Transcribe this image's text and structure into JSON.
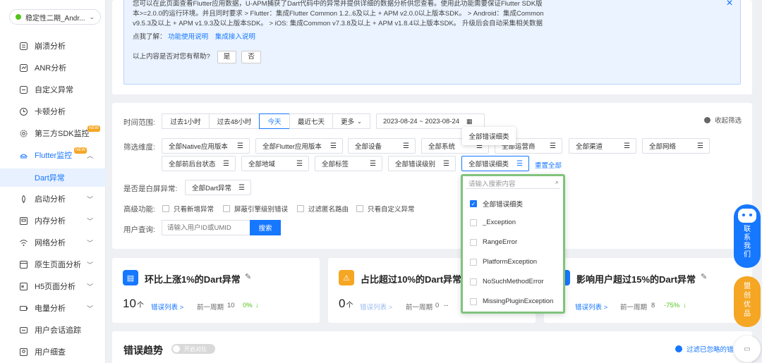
{
  "sidebar": {
    "app_name": "稳定性二期_Andr...",
    "items": [
      {
        "label": "崩溃分析"
      },
      {
        "label": "ANR分析"
      },
      {
        "label": "自定义异常"
      },
      {
        "label": "卡顿分析"
      },
      {
        "label": "第三方SDK监控",
        "badge": "NEW"
      },
      {
        "label": "Flutter监控",
        "badge": "NEW"
      },
      {
        "label": "启动分析"
      },
      {
        "label": "内存分析"
      },
      {
        "label": "网络分析"
      },
      {
        "label": "原生页面分析"
      },
      {
        "label": "H5页面分析"
      },
      {
        "label": "电量分析"
      },
      {
        "label": "用户会话追踪"
      },
      {
        "label": "用户细查"
      }
    ],
    "active_sub": "Dart异常"
  },
  "notice": {
    "text": "您可以在此页面查看Flutter应用数据，U-APM捕获了Dart代码中的异常并提供详细的数据分析供您查看。使用此功能需要保证Flutter SDK版本>=2.0.0的运行环境。并且同时要求 > Flutter：集成Flutter Common 1.2..6及以上 + APM v2.0.0以上版本SDK。 > Android：集成Common v9.5.3及以上 + APM v1.9.3及以上版本SDK。 > iOS: 集成Common v7.3.8及以上 + APM v1.8.4以上版本SDK。 升级后会自动采集相关数据",
    "learn_prefix": "点我了解：",
    "link1": "功能使用说明",
    "link2": "集成接入说明",
    "help_q": "以上内容是否对您有帮助?",
    "yes": "是",
    "no": "否"
  },
  "filters": {
    "time_label": "时间范围:",
    "time_options": [
      "过去1小时",
      "过去48小时",
      "今天",
      "最近七天",
      "更多"
    ],
    "date_range": "2023-08-24 ~ 2023-08-24",
    "collapse": "收起筛选",
    "dim_label": "筛选维度:",
    "dims_row1": [
      "全部Native应用版本",
      "全部Flutter应用版本",
      "全部设备",
      "全部系统",
      "全部运营商",
      "全部渠道",
      "全部网络"
    ],
    "dims_row2": [
      "全部前后台状态",
      "全部地域",
      "全部标签",
      "全部错误级别",
      "全部错误细类"
    ],
    "reset": "重置全部",
    "white_label": "是否是白屏异常:",
    "white_value": "全部Dart异常",
    "adv_label": "高级功能:",
    "adv_options": [
      "只看新增异常",
      "屏蔽引擎级别错误",
      "过滤匿名路由",
      "只看自定义异常"
    ],
    "user_label": "用户查询:",
    "user_placeholder": "请输入用户ID或UMID",
    "search_btn": "搜索"
  },
  "tooltip": "全部错误细类",
  "dropdown": {
    "placeholder": "请输入搜索内容",
    "options": [
      {
        "label": "全部错误细类",
        "checked": true
      },
      {
        "label": "_Exception",
        "checked": false
      },
      {
        "label": "RangeError",
        "checked": false
      },
      {
        "label": "PlatformException",
        "checked": false
      },
      {
        "label": "NoSuchMethodError",
        "checked": false
      },
      {
        "label": "MissingPluginException",
        "checked": false
      }
    ]
  },
  "kpis": [
    {
      "title": "环比上涨1%的Dart异常",
      "value": "10",
      "unit": "个",
      "link": "错误列表 >",
      "prev_label": "前一周期",
      "prev_value": "10",
      "change": "0%",
      "color": "#1677ff"
    },
    {
      "title": "占比超过10%的Dart异常",
      "value": "0",
      "unit": "个",
      "link": "错误列表 >",
      "prev_label": "前一周期",
      "prev_value": "0",
      "change": "--",
      "color": "#f5a623"
    },
    {
      "title": "影响用户超过15%的Dart异常",
      "value": "",
      "unit": "个",
      "link": "错误列表 >",
      "prev_label": "前一周期",
      "prev_value": "8",
      "change": "-75%",
      "color": "#1677ff"
    }
  ],
  "trend": {
    "title": "错误趋势",
    "toggle": "开启对比",
    "filter_note": "过滤已忽略的错"
  },
  "float": {
    "contact": "联系我们",
    "promo": "盟创优品"
  }
}
